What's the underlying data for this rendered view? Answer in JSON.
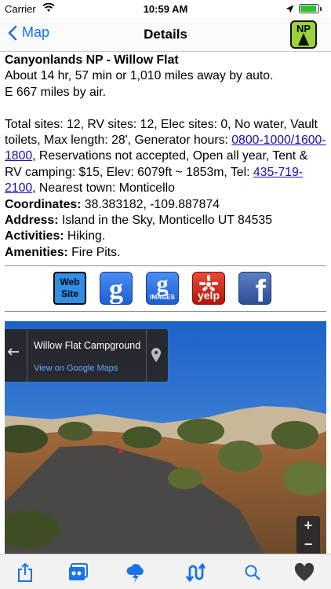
{
  "status_bar": {
    "carrier": "Carrier",
    "time": "10:59 AM",
    "battery_level": 0.9
  },
  "nav": {
    "back_label": "Map",
    "title": "Details",
    "logo_text": "NP"
  },
  "details": {
    "name": "Canyonlands NP - Willow Flat",
    "distance_auto": "About 14 hr, 57 min or 1,010 miles away by auto.",
    "distance_air": "E 667 miles by air.",
    "description_start": "Total sites: 12, RV sites: 12, Elec sites: 0, No water, Vault toilets, Max length: 28', Generator hours: ",
    "generator_hours_link": "0800-1000/1600-1800",
    "description_mid": ", Reservations not accepted, Open all year, Tent & RV camping: $15, Elev: 6079ft ~ 1853m, Tel: ",
    "phone_link": "435-719-2100",
    "description_end": ", Nearest town: Monticello",
    "coordinates_label": "Coordinates:",
    "coordinates_value": " 38.383182, -109.887874",
    "address_label": "Address:",
    "address_value": " Island in the Sky, Monticello UT 84535",
    "activities_label": "Activities:",
    "activities_value": " Hiking.",
    "amenities_label": "Amenities:",
    "amenities_value": " Fire Pits."
  },
  "links": {
    "website_line1": "Web",
    "website_line2": "Site",
    "google_glyph": "g",
    "images_glyph": "g",
    "images_label": "IMAGES",
    "yelp_label": "yelp",
    "facebook_glyph": "f"
  },
  "street_view": {
    "place_name": "Willow Flat Campground",
    "view_link": "View on Google Maps",
    "zoom_in": "+",
    "zoom_out": "−"
  },
  "tab_bar": {
    "items": [
      "share-icon",
      "gallery-icon",
      "weather-icon",
      "directions-icon",
      "search-icon",
      "favorite-heart-icon"
    ]
  },
  "colors": {
    "accent": "#1a73e8",
    "link": "#1a0dab",
    "logo_green": "#9dd33a"
  }
}
